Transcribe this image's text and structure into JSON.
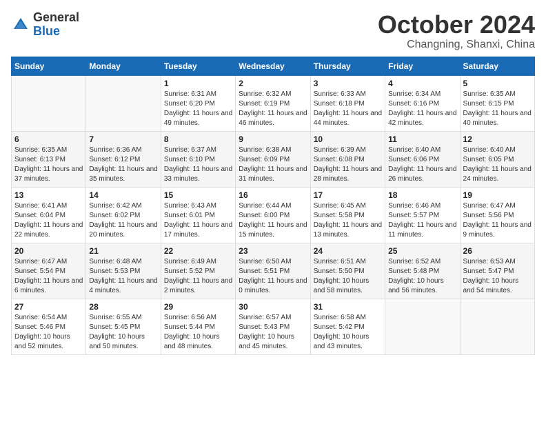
{
  "header": {
    "logo_line1": "General",
    "logo_line2": "Blue",
    "month": "October 2024",
    "location": "Changning, Shanxi, China"
  },
  "weekdays": [
    "Sunday",
    "Monday",
    "Tuesday",
    "Wednesday",
    "Thursday",
    "Friday",
    "Saturday"
  ],
  "weeks": [
    [
      {
        "day": "",
        "sunrise": "",
        "sunset": "",
        "daylight": ""
      },
      {
        "day": "",
        "sunrise": "",
        "sunset": "",
        "daylight": ""
      },
      {
        "day": "1",
        "sunrise": "Sunrise: 6:31 AM",
        "sunset": "Sunset: 6:20 PM",
        "daylight": "Daylight: 11 hours and 49 minutes."
      },
      {
        "day": "2",
        "sunrise": "Sunrise: 6:32 AM",
        "sunset": "Sunset: 6:19 PM",
        "daylight": "Daylight: 11 hours and 46 minutes."
      },
      {
        "day": "3",
        "sunrise": "Sunrise: 6:33 AM",
        "sunset": "Sunset: 6:18 PM",
        "daylight": "Daylight: 11 hours and 44 minutes."
      },
      {
        "day": "4",
        "sunrise": "Sunrise: 6:34 AM",
        "sunset": "Sunset: 6:16 PM",
        "daylight": "Daylight: 11 hours and 42 minutes."
      },
      {
        "day": "5",
        "sunrise": "Sunrise: 6:35 AM",
        "sunset": "Sunset: 6:15 PM",
        "daylight": "Daylight: 11 hours and 40 minutes."
      }
    ],
    [
      {
        "day": "6",
        "sunrise": "Sunrise: 6:35 AM",
        "sunset": "Sunset: 6:13 PM",
        "daylight": "Daylight: 11 hours and 37 minutes."
      },
      {
        "day": "7",
        "sunrise": "Sunrise: 6:36 AM",
        "sunset": "Sunset: 6:12 PM",
        "daylight": "Daylight: 11 hours and 35 minutes."
      },
      {
        "day": "8",
        "sunrise": "Sunrise: 6:37 AM",
        "sunset": "Sunset: 6:10 PM",
        "daylight": "Daylight: 11 hours and 33 minutes."
      },
      {
        "day": "9",
        "sunrise": "Sunrise: 6:38 AM",
        "sunset": "Sunset: 6:09 PM",
        "daylight": "Daylight: 11 hours and 31 minutes."
      },
      {
        "day": "10",
        "sunrise": "Sunrise: 6:39 AM",
        "sunset": "Sunset: 6:08 PM",
        "daylight": "Daylight: 11 hours and 28 minutes."
      },
      {
        "day": "11",
        "sunrise": "Sunrise: 6:40 AM",
        "sunset": "Sunset: 6:06 PM",
        "daylight": "Daylight: 11 hours and 26 minutes."
      },
      {
        "day": "12",
        "sunrise": "Sunrise: 6:40 AM",
        "sunset": "Sunset: 6:05 PM",
        "daylight": "Daylight: 11 hours and 24 minutes."
      }
    ],
    [
      {
        "day": "13",
        "sunrise": "Sunrise: 6:41 AM",
        "sunset": "Sunset: 6:04 PM",
        "daylight": "Daylight: 11 hours and 22 minutes."
      },
      {
        "day": "14",
        "sunrise": "Sunrise: 6:42 AM",
        "sunset": "Sunset: 6:02 PM",
        "daylight": "Daylight: 11 hours and 20 minutes."
      },
      {
        "day": "15",
        "sunrise": "Sunrise: 6:43 AM",
        "sunset": "Sunset: 6:01 PM",
        "daylight": "Daylight: 11 hours and 17 minutes."
      },
      {
        "day": "16",
        "sunrise": "Sunrise: 6:44 AM",
        "sunset": "Sunset: 6:00 PM",
        "daylight": "Daylight: 11 hours and 15 minutes."
      },
      {
        "day": "17",
        "sunrise": "Sunrise: 6:45 AM",
        "sunset": "Sunset: 5:58 PM",
        "daylight": "Daylight: 11 hours and 13 minutes."
      },
      {
        "day": "18",
        "sunrise": "Sunrise: 6:46 AM",
        "sunset": "Sunset: 5:57 PM",
        "daylight": "Daylight: 11 hours and 11 minutes."
      },
      {
        "day": "19",
        "sunrise": "Sunrise: 6:47 AM",
        "sunset": "Sunset: 5:56 PM",
        "daylight": "Daylight: 11 hours and 9 minutes."
      }
    ],
    [
      {
        "day": "20",
        "sunrise": "Sunrise: 6:47 AM",
        "sunset": "Sunset: 5:54 PM",
        "daylight": "Daylight: 11 hours and 6 minutes."
      },
      {
        "day": "21",
        "sunrise": "Sunrise: 6:48 AM",
        "sunset": "Sunset: 5:53 PM",
        "daylight": "Daylight: 11 hours and 4 minutes."
      },
      {
        "day": "22",
        "sunrise": "Sunrise: 6:49 AM",
        "sunset": "Sunset: 5:52 PM",
        "daylight": "Daylight: 11 hours and 2 minutes."
      },
      {
        "day": "23",
        "sunrise": "Sunrise: 6:50 AM",
        "sunset": "Sunset: 5:51 PM",
        "daylight": "Daylight: 11 hours and 0 minutes."
      },
      {
        "day": "24",
        "sunrise": "Sunrise: 6:51 AM",
        "sunset": "Sunset: 5:50 PM",
        "daylight": "Daylight: 10 hours and 58 minutes."
      },
      {
        "day": "25",
        "sunrise": "Sunrise: 6:52 AM",
        "sunset": "Sunset: 5:48 PM",
        "daylight": "Daylight: 10 hours and 56 minutes."
      },
      {
        "day": "26",
        "sunrise": "Sunrise: 6:53 AM",
        "sunset": "Sunset: 5:47 PM",
        "daylight": "Daylight: 10 hours and 54 minutes."
      }
    ],
    [
      {
        "day": "27",
        "sunrise": "Sunrise: 6:54 AM",
        "sunset": "Sunset: 5:46 PM",
        "daylight": "Daylight: 10 hours and 52 minutes."
      },
      {
        "day": "28",
        "sunrise": "Sunrise: 6:55 AM",
        "sunset": "Sunset: 5:45 PM",
        "daylight": "Daylight: 10 hours and 50 minutes."
      },
      {
        "day": "29",
        "sunrise": "Sunrise: 6:56 AM",
        "sunset": "Sunset: 5:44 PM",
        "daylight": "Daylight: 10 hours and 48 minutes."
      },
      {
        "day": "30",
        "sunrise": "Sunrise: 6:57 AM",
        "sunset": "Sunset: 5:43 PM",
        "daylight": "Daylight: 10 hours and 45 minutes."
      },
      {
        "day": "31",
        "sunrise": "Sunrise: 6:58 AM",
        "sunset": "Sunset: 5:42 PM",
        "daylight": "Daylight: 10 hours and 43 minutes."
      },
      {
        "day": "",
        "sunrise": "",
        "sunset": "",
        "daylight": ""
      },
      {
        "day": "",
        "sunrise": "",
        "sunset": "",
        "daylight": ""
      }
    ]
  ]
}
